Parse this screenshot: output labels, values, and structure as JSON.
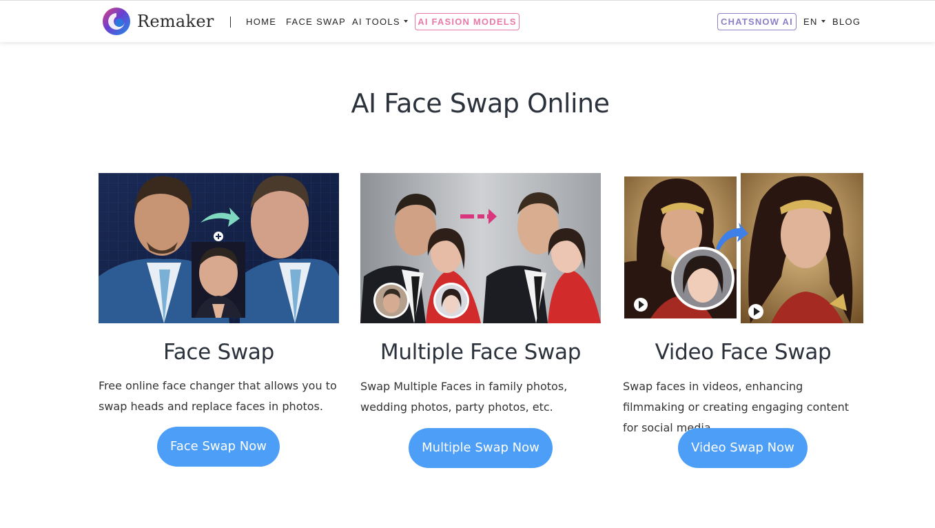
{
  "nav": {
    "brand": "Remaker",
    "links": [
      {
        "label": "HOME"
      },
      {
        "label": "FACE SWAP"
      },
      {
        "label": "AI TOOLS"
      },
      {
        "label": "AI FASION MODELS"
      },
      {
        "label": "CHATSNOW AI"
      },
      {
        "label": "EN"
      },
      {
        "label": "BLOG"
      }
    ]
  },
  "page": {
    "title": "AI Face Swap Online"
  },
  "cards": [
    {
      "title": "Face Swap",
      "description": "Free online face changer that allows you to swap heads and replace faces in photos.",
      "button": "Face Swap Now"
    },
    {
      "title": "Multiple Face Swap",
      "description": "Swap Multiple Faces in family photos, wedding photos, party photos, etc.",
      "button": "Multiple Swap Now"
    },
    {
      "title": "Video Face Swap",
      "description": "Swap faces in videos, enhancing filmmaking or creating engaging content for social media.",
      "button": "Video Swap Now"
    }
  ],
  "colors": {
    "button_bg": "#4d9ef7",
    "pill_pink": "#e879a6",
    "pill_purple": "#8a80c8",
    "heading": "#2b323b"
  }
}
